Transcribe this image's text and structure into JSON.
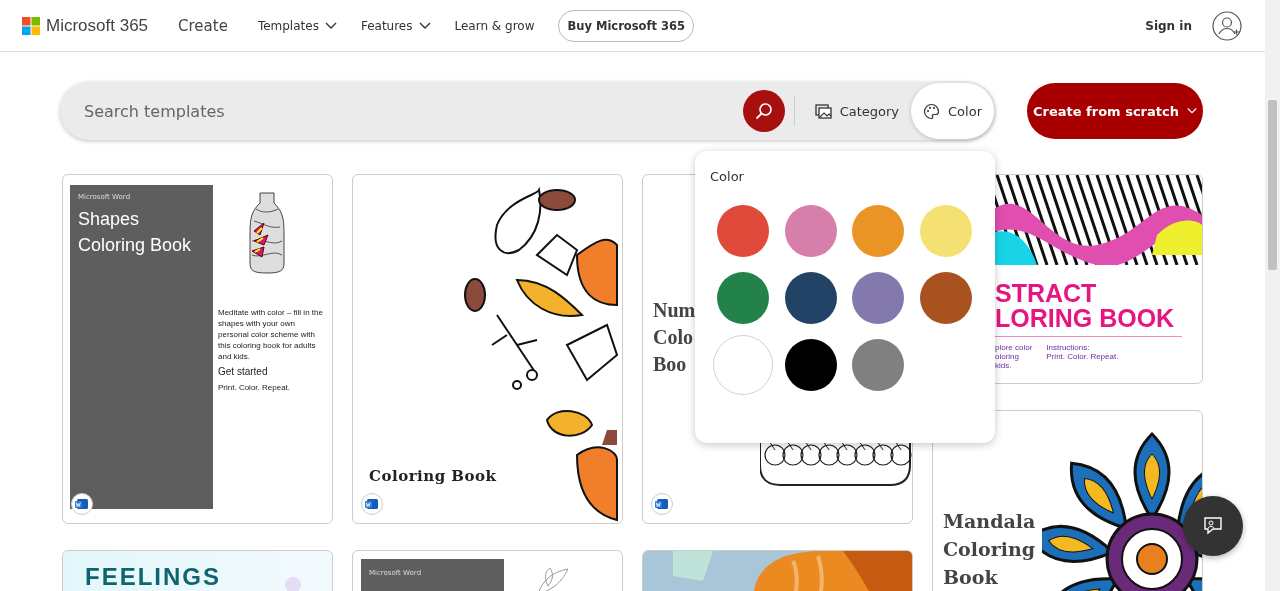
{
  "header": {
    "logo_text": "Microsoft 365",
    "nav": [
      {
        "label": "Create",
        "kind": "section"
      },
      {
        "label": "Templates",
        "kind": "dropdown"
      },
      {
        "label": "Features",
        "kind": "dropdown"
      },
      {
        "label": "Learn & grow",
        "kind": "link"
      },
      {
        "label": "Buy Microsoft 365",
        "kind": "button"
      }
    ],
    "sign_in": "Sign in"
  },
  "search": {
    "placeholder": "Search templates",
    "filters": [
      {
        "label": "Category",
        "kind": "category",
        "selected": false
      },
      {
        "label": "Color",
        "kind": "color",
        "selected": true
      }
    ],
    "create_button": "Create from scratch"
  },
  "color_popup": {
    "title": "Color",
    "swatches": [
      {
        "color": "#e04a3a"
      },
      {
        "color": "#d67fab"
      },
      {
        "color": "#ea9426"
      },
      {
        "color": "#f5e173"
      },
      {
        "color": "#23824a"
      },
      {
        "color": "#224266"
      },
      {
        "color": "#8479ad"
      },
      {
        "color": "#a8531f"
      },
      {
        "color": "#ffffff"
      },
      {
        "color": "#000000"
      },
      {
        "color": "#808080"
      }
    ]
  },
  "template_columns": [
    [
      {
        "kind": "shapes",
        "label": "Microsoft Word",
        "title": "Shapes Coloring Book",
        "description": "Meditate with color – fill in the shapes with your own personal color scheme with this coloring book for adults and kids.",
        "heading": "Get started",
        "tagline": "Print. Color. Repeat.",
        "word_badge": true
      },
      {
        "kind": "feelings",
        "title": "FEELINGS"
      }
    ],
    [
      {
        "kind": "leaves",
        "title": "Coloring Book",
        "word_badge": true
      },
      {
        "kind": "vintage",
        "label": "Microsoft Word"
      }
    ],
    [
      {
        "kind": "numbers",
        "title_lines": [
          "Num",
          "Colo",
          "Boo"
        ],
        "word_badge": true
      },
      {
        "kind": "painting"
      }
    ],
    [
      {
        "kind": "abstract",
        "title_lines": [
          "STRACT",
          "LORING BOOK"
        ],
        "note_lines": [
          "plore color",
          "oloring",
          "kids."
        ],
        "instruction_lines": [
          "Instructions:",
          "Print. Color. Repeat."
        ]
      },
      {
        "kind": "mandala",
        "title": "Mandala Coloring Book"
      }
    ]
  ]
}
